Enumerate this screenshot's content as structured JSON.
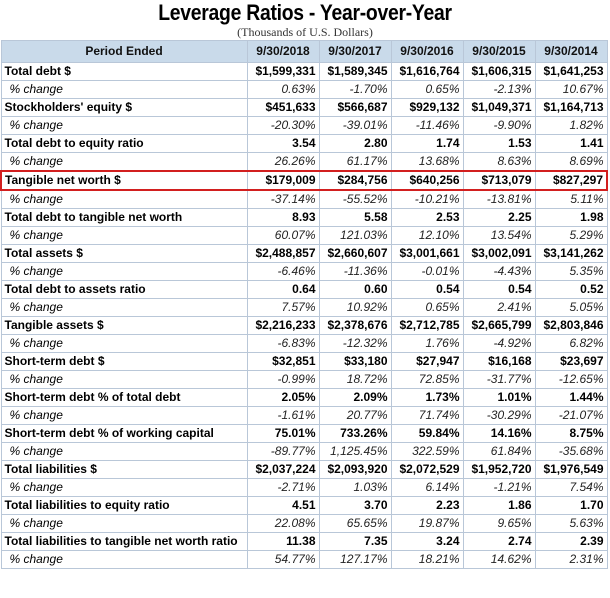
{
  "header": {
    "title": "Leverage Ratios - Year-over-Year",
    "subtitle": "(Thousands of U.S. Dollars)"
  },
  "table": {
    "columns": [
      "Period Ended",
      "9/30/2018",
      "9/30/2017",
      "9/30/2016",
      "9/30/2015",
      "9/30/2014"
    ],
    "highlight_color": "#d21f1f",
    "highlighted_row": "Tangible net worth $",
    "rows": [
      {
        "label": "Total debt $",
        "type": "main",
        "values": [
          "$1,599,331",
          "$1,589,345",
          "$1,616,764",
          "$1,606,315",
          "$1,641,253"
        ]
      },
      {
        "label": "% change",
        "type": "sub",
        "values": [
          "0.63%",
          "-1.70%",
          "0.65%",
          "-2.13%",
          "10.67%"
        ]
      },
      {
        "label": "Stockholders' equity $",
        "type": "main",
        "values": [
          "$451,633",
          "$566,687",
          "$929,132",
          "$1,049,371",
          "$1,164,713"
        ]
      },
      {
        "label": "% change",
        "type": "sub",
        "values": [
          "-20.30%",
          "-39.01%",
          "-11.46%",
          "-9.90%",
          "1.82%"
        ]
      },
      {
        "label": "Total debt to equity ratio",
        "type": "main",
        "values": [
          "3.54",
          "2.80",
          "1.74",
          "1.53",
          "1.41"
        ]
      },
      {
        "label": "% change",
        "type": "sub",
        "values": [
          "26.26%",
          "61.17%",
          "13.68%",
          "8.63%",
          "8.69%"
        ]
      },
      {
        "label": "Tangible net worth $",
        "type": "main",
        "values": [
          "$179,009",
          "$284,756",
          "$640,256",
          "$713,079",
          "$827,297"
        ]
      },
      {
        "label": "% change",
        "type": "sub",
        "values": [
          "-37.14%",
          "-55.52%",
          "-10.21%",
          "-13.81%",
          "5.11%"
        ]
      },
      {
        "label": "Total debt to tangible net worth",
        "type": "main",
        "values": [
          "8.93",
          "5.58",
          "2.53",
          "2.25",
          "1.98"
        ]
      },
      {
        "label": "% change",
        "type": "sub",
        "values": [
          "60.07%",
          "121.03%",
          "12.10%",
          "13.54%",
          "5.29%"
        ]
      },
      {
        "label": "Total assets $",
        "type": "main",
        "values": [
          "$2,488,857",
          "$2,660,607",
          "$3,001,661",
          "$3,002,091",
          "$3,141,262"
        ]
      },
      {
        "label": "% change",
        "type": "sub",
        "values": [
          "-6.46%",
          "-11.36%",
          "-0.01%",
          "-4.43%",
          "5.35%"
        ]
      },
      {
        "label": "Total debt to assets ratio",
        "type": "main",
        "values": [
          "0.64",
          "0.60",
          "0.54",
          "0.54",
          "0.52"
        ]
      },
      {
        "label": "% change",
        "type": "sub",
        "values": [
          "7.57%",
          "10.92%",
          "0.65%",
          "2.41%",
          "5.05%"
        ]
      },
      {
        "label": "Tangible assets $",
        "type": "main",
        "values": [
          "$2,216,233",
          "$2,378,676",
          "$2,712,785",
          "$2,665,799",
          "$2,803,846"
        ]
      },
      {
        "label": "% change",
        "type": "sub",
        "values": [
          "-6.83%",
          "-12.32%",
          "1.76%",
          "-4.92%",
          "6.82%"
        ]
      },
      {
        "label": "Short-term debt $",
        "type": "main",
        "values": [
          "$32,851",
          "$33,180",
          "$27,947",
          "$16,168",
          "$23,697"
        ]
      },
      {
        "label": "% change",
        "type": "sub",
        "values": [
          "-0.99%",
          "18.72%",
          "72.85%",
          "-31.77%",
          "-12.65%"
        ]
      },
      {
        "label": "Short-term debt % of total debt",
        "type": "main",
        "values": [
          "2.05%",
          "2.09%",
          "1.73%",
          "1.01%",
          "1.44%"
        ]
      },
      {
        "label": "% change",
        "type": "sub",
        "values": [
          "-1.61%",
          "20.77%",
          "71.74%",
          "-30.29%",
          "-21.07%"
        ]
      },
      {
        "label": "Short-term debt % of working capital",
        "type": "main",
        "values": [
          "75.01%",
          "733.26%",
          "59.84%",
          "14.16%",
          "8.75%"
        ]
      },
      {
        "label": "% change",
        "type": "sub",
        "values": [
          "-89.77%",
          "1,125.45%",
          "322.59%",
          "61.84%",
          "-35.68%"
        ]
      },
      {
        "label": "Total liabilities $",
        "type": "main",
        "values": [
          "$2,037,224",
          "$2,093,920",
          "$2,072,529",
          "$1,952,720",
          "$1,976,549"
        ]
      },
      {
        "label": "% change",
        "type": "sub",
        "values": [
          "-2.71%",
          "1.03%",
          "6.14%",
          "-1.21%",
          "7.54%"
        ]
      },
      {
        "label": "Total liabilities to equity ratio",
        "type": "main",
        "values": [
          "4.51",
          "3.70",
          "2.23",
          "1.86",
          "1.70"
        ]
      },
      {
        "label": "% change",
        "type": "sub",
        "values": [
          "22.08%",
          "65.65%",
          "19.87%",
          "9.65%",
          "5.63%"
        ]
      },
      {
        "label": "Total liabilities to tangible net worth ratio",
        "type": "main",
        "values": [
          "11.38",
          "7.35",
          "3.24",
          "2.74",
          "2.39"
        ]
      },
      {
        "label": "% change",
        "type": "sub",
        "values": [
          "54.77%",
          "127.17%",
          "18.21%",
          "14.62%",
          "2.31%"
        ]
      }
    ]
  }
}
